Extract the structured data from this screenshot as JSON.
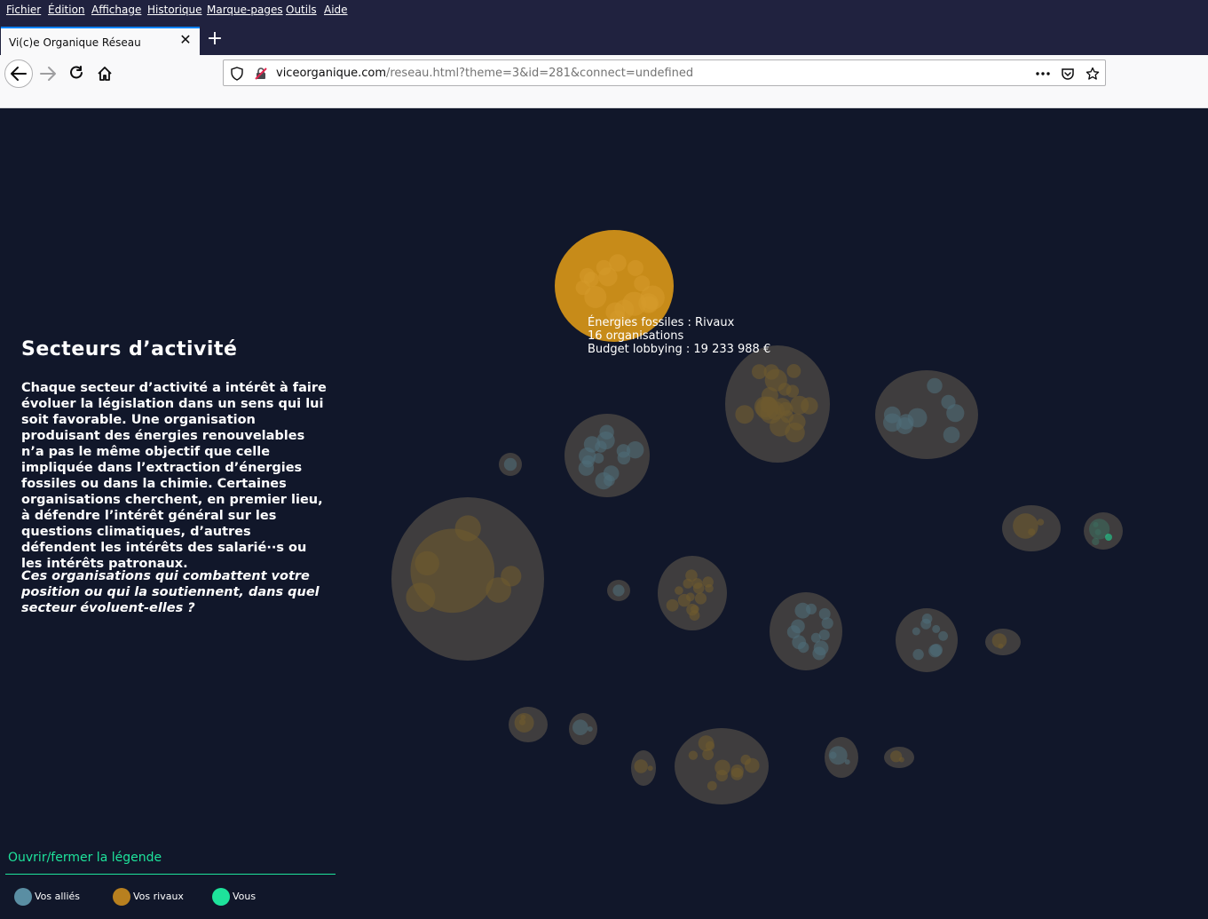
{
  "browser": {
    "menu": [
      "Fichier",
      "Édition",
      "Affichage",
      "Historique",
      "Marque-pages",
      "Outils",
      "Aide"
    ],
    "tab_title": "Vi(c)e Organique Réseau",
    "tab_close": "✕",
    "new_tab": "+",
    "url_host": "viceorganique.com",
    "url_path": "/reseau.html?theme=3&id=281&connect=undefined"
  },
  "panel": {
    "title": "Secteurs d’activité",
    "description": "Chaque secteur d’activité a intérêt à faire évoluer la législation dans un sens qui lui soit favorable. Une organisation produisant des énergies renouvelables n’a pas le même objectif que celle impliquée dans l’extraction d’énergies fossiles ou dans la chimie. Certaines organisations cherchent, en premier lieu, à défendre l’intérêt général sur les questions climatiques, d’autres défendent les intérêts des salarié··s ou les intérêts patronaux.",
    "question": "Ces organisations qui combattent votre position ou qui la soutiennent, dans quel secteur évoluent-elles ?"
  },
  "tooltip": {
    "line1": "Énergies fossiles : Rivaux",
    "line2": "16 organisations",
    "line3": "Budget lobbying : 19 233 988 €"
  },
  "legend": {
    "toggle": "Ouvrir/fermer la légende",
    "items": [
      {
        "label": "Vos alliés",
        "color": "#5a8ea3"
      },
      {
        "label": "Vos rivaux",
        "color": "#b8801f"
      },
      {
        "label": "Vous",
        "color": "#1ee39b"
      }
    ]
  },
  "colors": {
    "background": "#11172a",
    "cluster": "#3f3d3e",
    "highlight": "#c78b19",
    "ally": "#4f6c78",
    "rival": "#6e5a2e",
    "self": "#1ee39b"
  },
  "icons": [
    "back-icon",
    "forward-icon",
    "reload-icon",
    "home-icon",
    "shield-icon",
    "insecure-lock-icon",
    "more-icon",
    "pocket-icon",
    "star-icon"
  ]
}
